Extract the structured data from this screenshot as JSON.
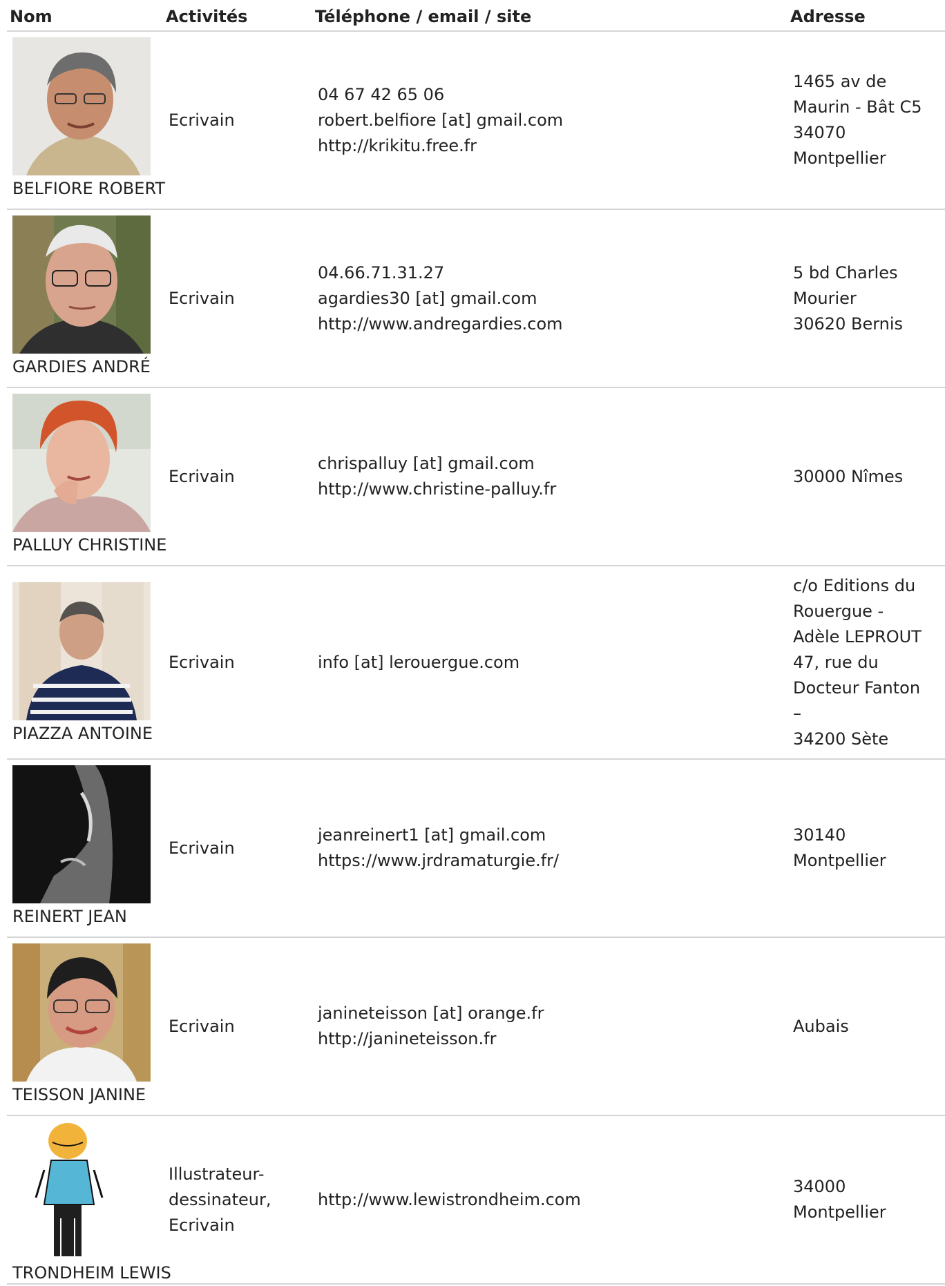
{
  "headers": {
    "name": "Nom",
    "activities": "Activités",
    "contact": "Téléphone / email / site",
    "address": "Adresse"
  },
  "rows": [
    {
      "name": "BELFIORE ROBERT",
      "activity": "Ecrivain",
      "phone": "04 67 42 65 06",
      "email": "robert.belfiore [at] gmail.com",
      "site": "http://krikitu.free.fr",
      "address": "1465 av de\nMaurin - Bât C5\n34070\nMontpellier"
    },
    {
      "name": "GARDIES ANDRÉ",
      "activity": "Ecrivain",
      "phone": "04.66.71.31.27",
      "email": "agardies30 [at] gmail.com",
      "site": "http://www.andregardies.com",
      "address": "5 bd Charles\nMourier\n30620 Bernis"
    },
    {
      "name": "PALLUY CHRISTINE",
      "activity": "Ecrivain",
      "email": "chrispalluy [at] gmail.com",
      "site": "http://www.christine-palluy.fr",
      "address": "30000 Nîmes"
    },
    {
      "name": "PIAZZA ANTOINE",
      "activity": "Ecrivain",
      "email": "info [at] lerouergue.com",
      "address": "c/o Editions du\nRouergue -\nAdèle LEPROUT\n47, rue du\nDocteur Fanton\n–\n34200 Sète"
    },
    {
      "name": "REINERT JEAN",
      "activity": "Ecrivain",
      "email": "jeanreinert1 [at] gmail.com",
      "site": "https://www.jrdramaturgie.fr/",
      "address": "30140\nMontpellier"
    },
    {
      "name": "TEISSON JANINE",
      "activity": "Ecrivain",
      "email": "janineteisson [at] orange.fr",
      "site": "http://janineteisson.fr",
      "address": "Aubais"
    },
    {
      "name": "TRONDHEIM LEWIS",
      "activity": "Illustrateur-\ndessinateur,\nEcrivain",
      "site": "http://www.lewistrondheim.com",
      "address": "34000\nMontpellier"
    }
  ]
}
